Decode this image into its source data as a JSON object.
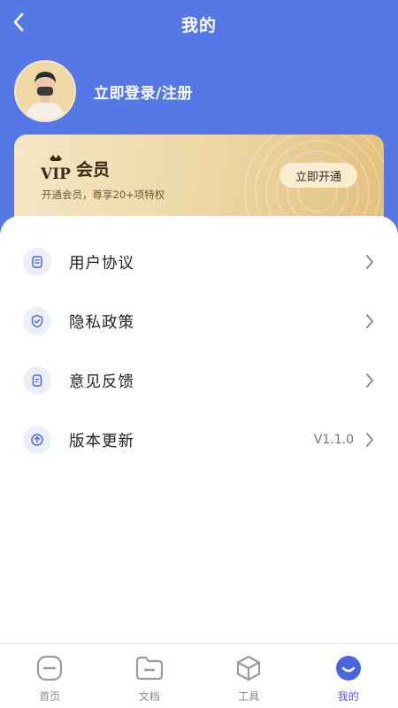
{
  "header": {
    "title": "我的",
    "back_icon": "chevron-left-icon"
  },
  "profile": {
    "login_text": "立即登录/注册"
  },
  "vip": {
    "logo_text": "VIP",
    "label": "会员",
    "subtitle": "开通会员，尊享20+项特权",
    "button": "立即开通"
  },
  "menu": {
    "items": [
      {
        "label": "用户协议",
        "icon": "document-icon",
        "value": ""
      },
      {
        "label": "隐私政策",
        "icon": "shield-icon",
        "value": ""
      },
      {
        "label": "意见反馈",
        "icon": "feedback-icon",
        "value": ""
      },
      {
        "label": "版本更新",
        "icon": "upload-icon",
        "value": "V1.1.0"
      }
    ]
  },
  "tabbar": {
    "tabs": [
      {
        "label": "首页",
        "icon": "home-icon",
        "active": false
      },
      {
        "label": "文档",
        "icon": "folder-icon",
        "active": false
      },
      {
        "label": "工具",
        "icon": "cube-icon",
        "active": false
      },
      {
        "label": "我的",
        "icon": "smile-icon",
        "active": true
      }
    ]
  },
  "colors": {
    "primary": "#5678e6",
    "tab_active": "#4a66de",
    "vip_gold": "#ecd6a2"
  }
}
